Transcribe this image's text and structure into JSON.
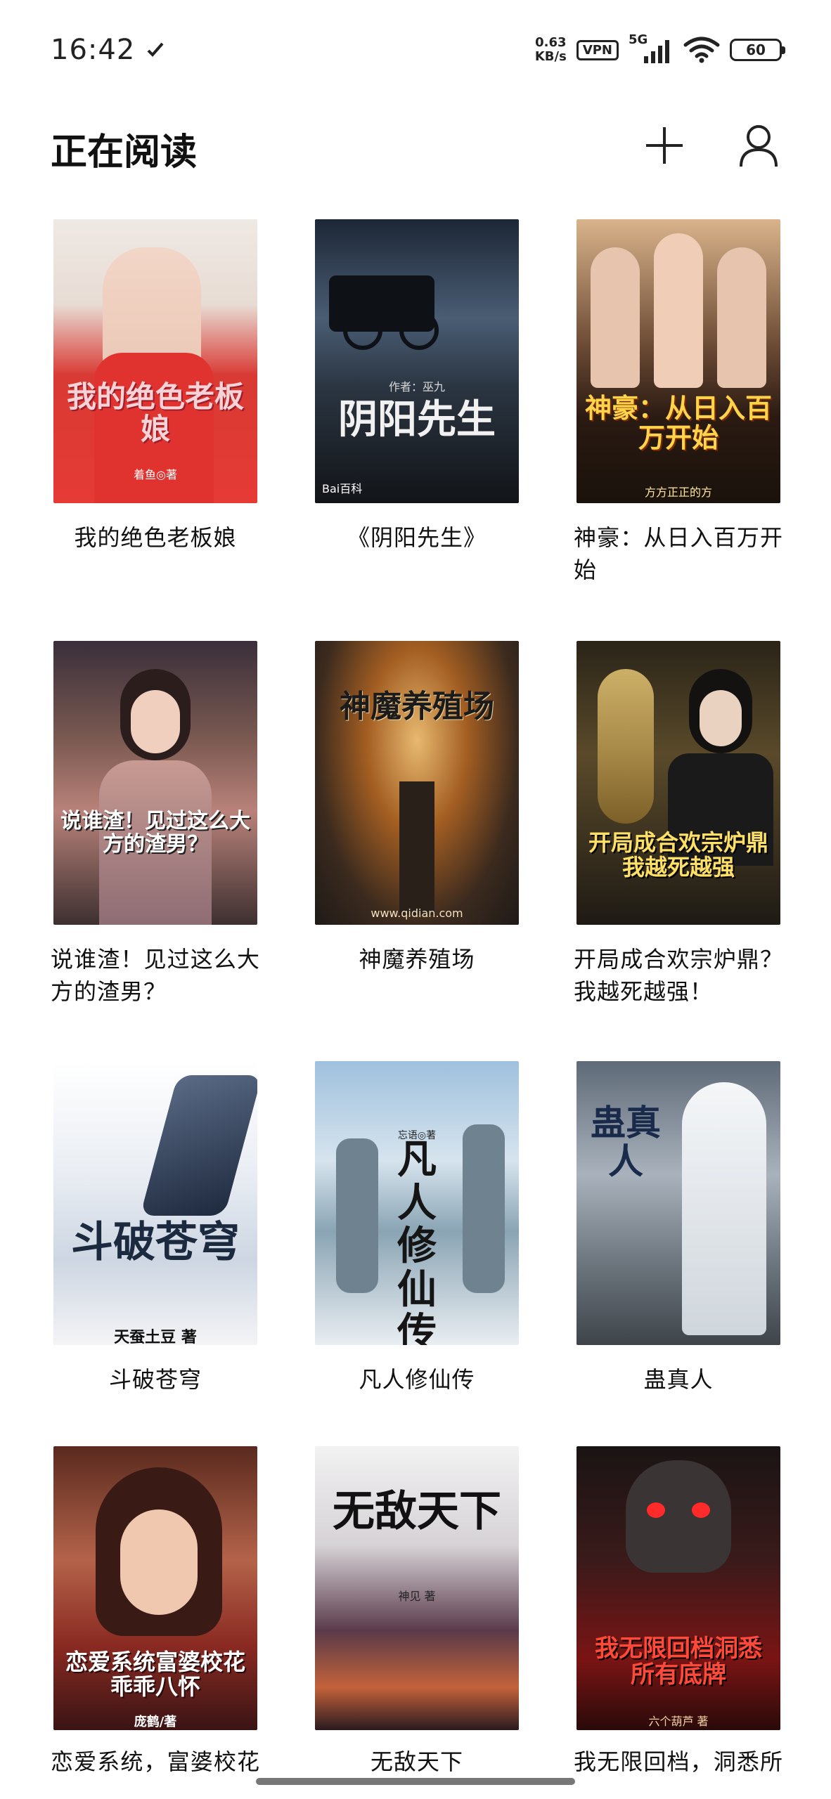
{
  "status_bar": {
    "time": "16:42",
    "net_speed_value": "0.63",
    "net_speed_unit": "KB/s",
    "vpn": "VPN",
    "network": "5G",
    "battery": "60"
  },
  "header": {
    "title": "正在阅读",
    "add_icon": "plus-icon",
    "profile_icon": "user-icon"
  },
  "books": [
    {
      "title": "我的绝色老板娘",
      "cover_text": "我的绝色老板娘",
      "cover_author": "着鱼◎著",
      "align": "center"
    },
    {
      "title": "《阴阳先生》",
      "cover_text": "阴阳先生",
      "cover_author": "作者：巫九",
      "align": "center"
    },
    {
      "title": "神豪：从日入百万开始",
      "cover_text": "神豪：从日入百万开始",
      "cover_author": "方方正正的方",
      "align": "left"
    },
    {
      "title": "说谁渣！见过这么大方的渣男？",
      "cover_text": "说谁渣！见过这么大方的渣男？",
      "cover_author": "",
      "align": "left"
    },
    {
      "title": "神魔养殖场",
      "cover_text": "神魔养殖场",
      "cover_author": "www.qidian.com",
      "align": "center"
    },
    {
      "title": "开局成合欢宗炉鼎？我越死越强！",
      "cover_text": "开局成合欢宗炉鼎我越死越强",
      "cover_author": "",
      "align": "left"
    },
    {
      "title": "斗破苍穹",
      "cover_text": "斗破苍穹",
      "cover_author": "天蚕土豆 著",
      "align": "center"
    },
    {
      "title": "凡人修仙传",
      "cover_text": "凡人修仙传",
      "cover_author": "忘语◎著",
      "align": "center"
    },
    {
      "title": "蛊真人",
      "cover_text": "蛊真人",
      "cover_author": "",
      "align": "center"
    },
    {
      "title": "恋爱系统，富婆校花乖乖八怀",
      "cover_text": "恋爱系统富婆校花乖乖八怀",
      "cover_author": "庞鹤/著",
      "align": "left"
    },
    {
      "title": "无敌天下",
      "cover_text": "无敌天下",
      "cover_author": "神见 著",
      "align": "center"
    },
    {
      "title": "我无限回档，洞悉所有底牌",
      "cover_text": "我无限回档洞悉所有底牌",
      "cover_author": "六个葫芦 著",
      "align": "left"
    }
  ]
}
